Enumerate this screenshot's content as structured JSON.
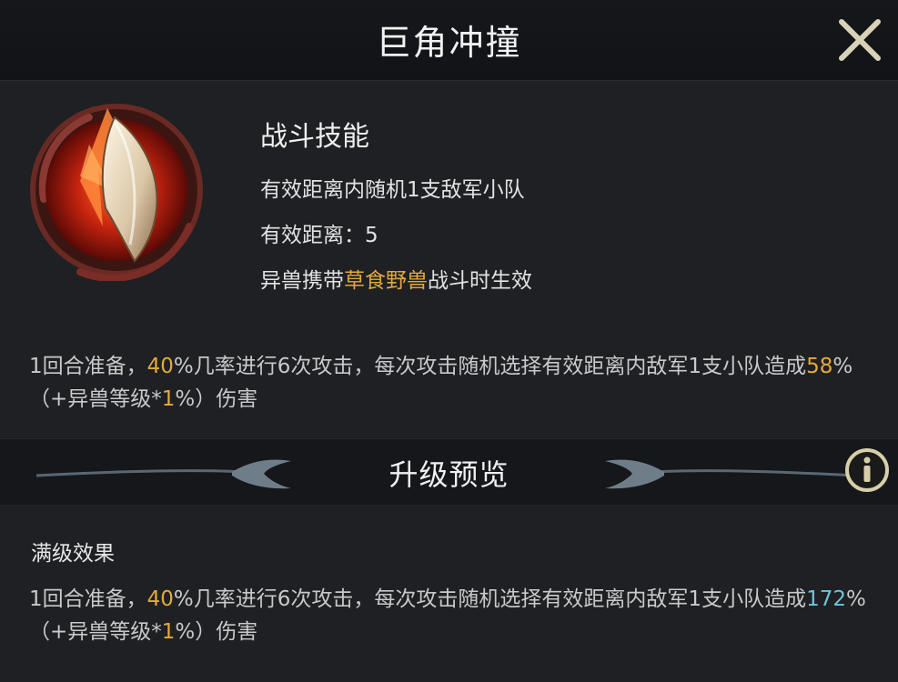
{
  "header": {
    "title": "巨角冲撞"
  },
  "skill": {
    "type": "战斗技能",
    "target": "有效距离内随机1支敌军小队",
    "range_label": "有效距离：",
    "range_value": "5",
    "condition_prefix": "异兽携带",
    "condition_highlight": "草食野兽",
    "condition_suffix": "战斗时生效",
    "description": {
      "p1": "1回合准备，",
      "chance": "40",
      "p2": "%几率进行",
      "count": "6",
      "p3": "次攻击，每次攻击随机选择有效距离内敌军",
      "num": "1",
      "p4": "支小队造成",
      "damage": "58",
      "p5": "%（+异兽等级*",
      "per_level": "1",
      "p6": "%）伤害"
    }
  },
  "preview": {
    "title": "升级预览"
  },
  "max_level": {
    "label": "满级效果",
    "description": {
      "p1": "1回合准备，",
      "chance": "40",
      "p2": "%几率进行",
      "count": "6",
      "p3": "次攻击，每次攻击随机选择有效距离内敌军",
      "num": "1",
      "p4": "支小队造成",
      "damage": "172",
      "p5": "%（+异兽等级*",
      "per_level": "1",
      "p6": "%）伤害"
    }
  },
  "icons": {
    "close": "close-icon",
    "info": "info-icon",
    "skill": "horn-skill-icon"
  },
  "colors": {
    "highlight_gold": "#e2a93a",
    "highlight_blue": "#6fc3dc"
  }
}
